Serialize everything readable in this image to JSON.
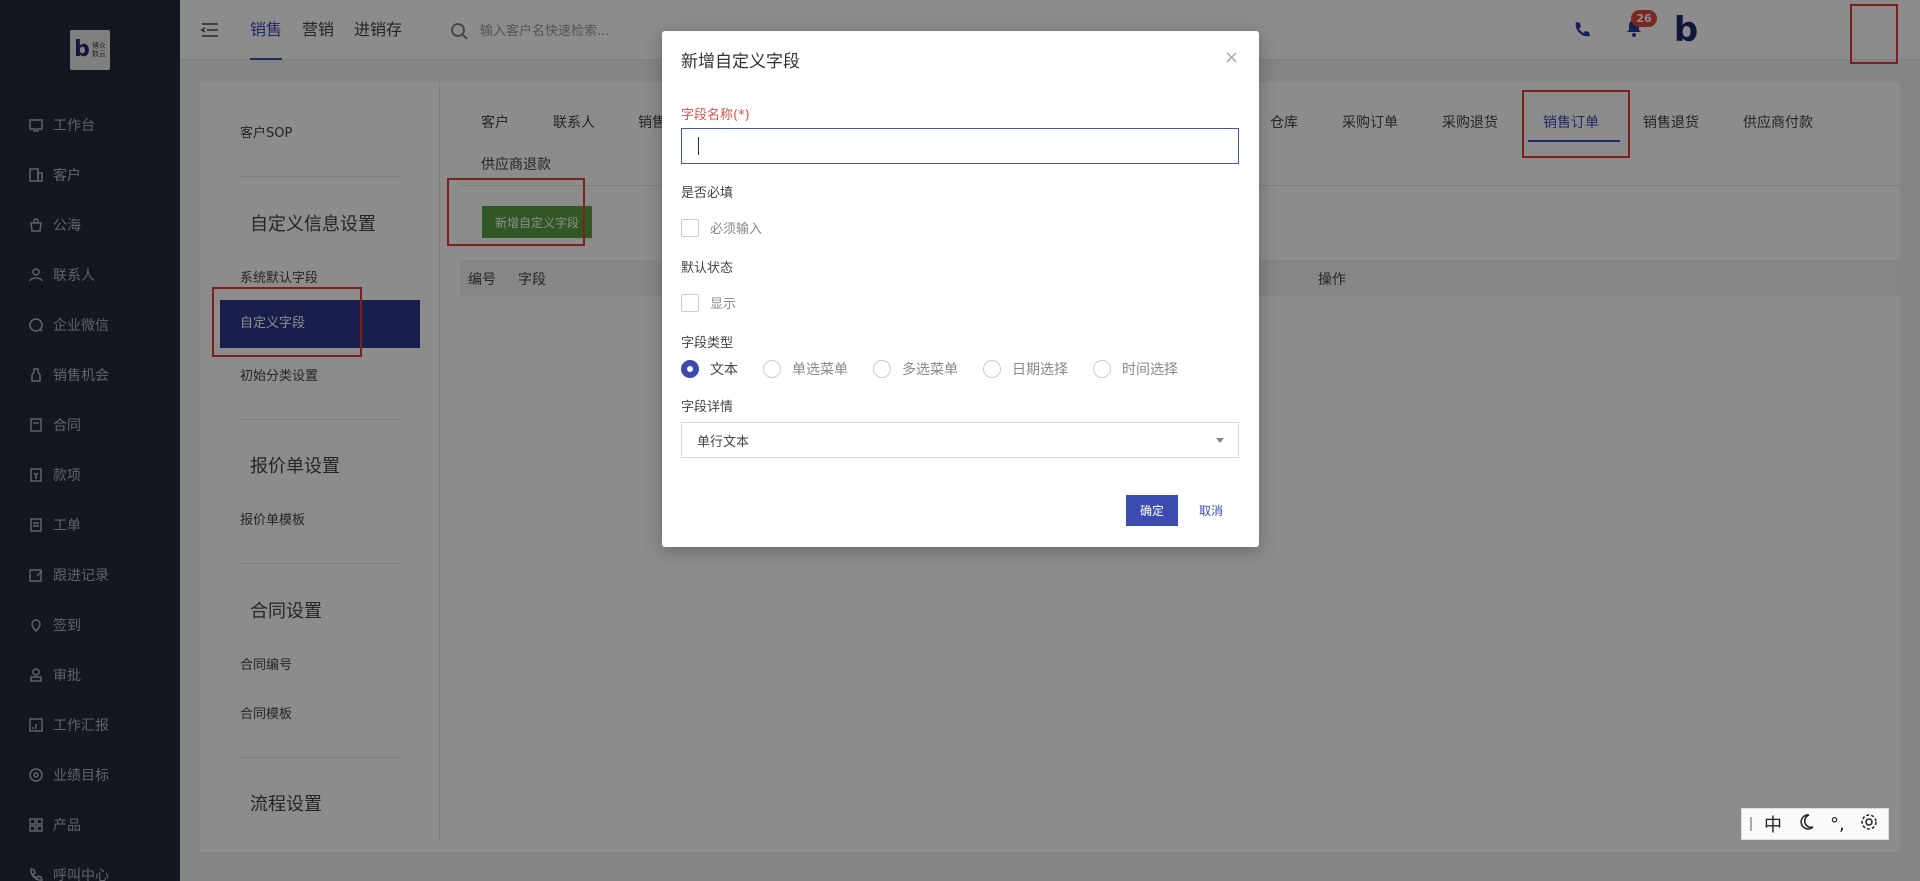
{
  "logo": {
    "line1": "博众",
    "line2": "数云"
  },
  "sidebar": {
    "items": [
      {
        "label": "工作台",
        "icon": "dashboard-icon"
      },
      {
        "label": "客户",
        "icon": "building-icon"
      },
      {
        "label": "公海",
        "icon": "bag-icon"
      },
      {
        "label": "联系人",
        "icon": "user-icon"
      },
      {
        "label": "企业微信",
        "icon": "chat-icon"
      },
      {
        "label": "销售机会",
        "icon": "bottle-icon"
      },
      {
        "label": "合同",
        "icon": "contract-icon"
      },
      {
        "label": "款项",
        "icon": "payment-icon"
      },
      {
        "label": "工单",
        "icon": "ticket-icon"
      },
      {
        "label": "跟进记录",
        "icon": "edit-icon"
      },
      {
        "label": "签到",
        "icon": "location-icon"
      },
      {
        "label": "审批",
        "icon": "approve-icon"
      },
      {
        "label": "工作汇报",
        "icon": "report-icon"
      },
      {
        "label": "业绩目标",
        "icon": "target-icon"
      },
      {
        "label": "产品",
        "icon": "grid-icon"
      },
      {
        "label": "呼叫中心",
        "icon": "phone-icon"
      }
    ]
  },
  "header": {
    "tabs": [
      "销售",
      "营销",
      "进销存"
    ],
    "active_tab": 0,
    "search_placeholder": "输入客户名快速检索...",
    "notification_count": "26",
    "avatar_letter": "b"
  },
  "settings_nav": {
    "top_item": "客户SOP",
    "sections": [
      {
        "title": "自定义信息设置",
        "items": [
          "系统默认字段",
          "自定义字段",
          "初始分类设置"
        ]
      },
      {
        "title": "报价单设置",
        "items": [
          "报价单模板"
        ]
      },
      {
        "title": "合同设置",
        "items": [
          "合同编号",
          "合同模板"
        ]
      },
      {
        "title": "流程设置",
        "items": []
      }
    ],
    "active_item": "自定义字段"
  },
  "module_tabs": {
    "row1": [
      "客户",
      "联系人",
      "销售",
      "仓库",
      "采购订单",
      "采购退货",
      "销售订单",
      "销售退货",
      "供应商付款"
    ],
    "row2": [
      "供应商退款"
    ],
    "active": "销售订单"
  },
  "main": {
    "add_button": "新增自定义字段",
    "table_columns": [
      "编号",
      "字段",
      "操作"
    ]
  },
  "modal": {
    "title": "新增自定义字段",
    "close": "×",
    "field_name_label": "字段名称(*)",
    "field_name_value": "",
    "required_label": "是否必填",
    "required_checkbox": "必须输入",
    "default_status_label": "默认状态",
    "default_status_checkbox": "显示",
    "field_type_label": "字段类型",
    "field_types": [
      "文本",
      "单选菜单",
      "多选菜单",
      "日期选择",
      "时间选择"
    ],
    "selected_type": "文本",
    "field_detail_label": "字段详情",
    "field_detail_value": "单行文本",
    "ok": "确定",
    "cancel": "取消"
  },
  "ime": {
    "lang": "中",
    "punct": "°,"
  },
  "colors": {
    "sidebar_bg": "#232a3b",
    "accent": "#3b4bb0",
    "add_button": "#5a9e44",
    "required": "#d9534f",
    "highlight": "#e03a3a"
  }
}
